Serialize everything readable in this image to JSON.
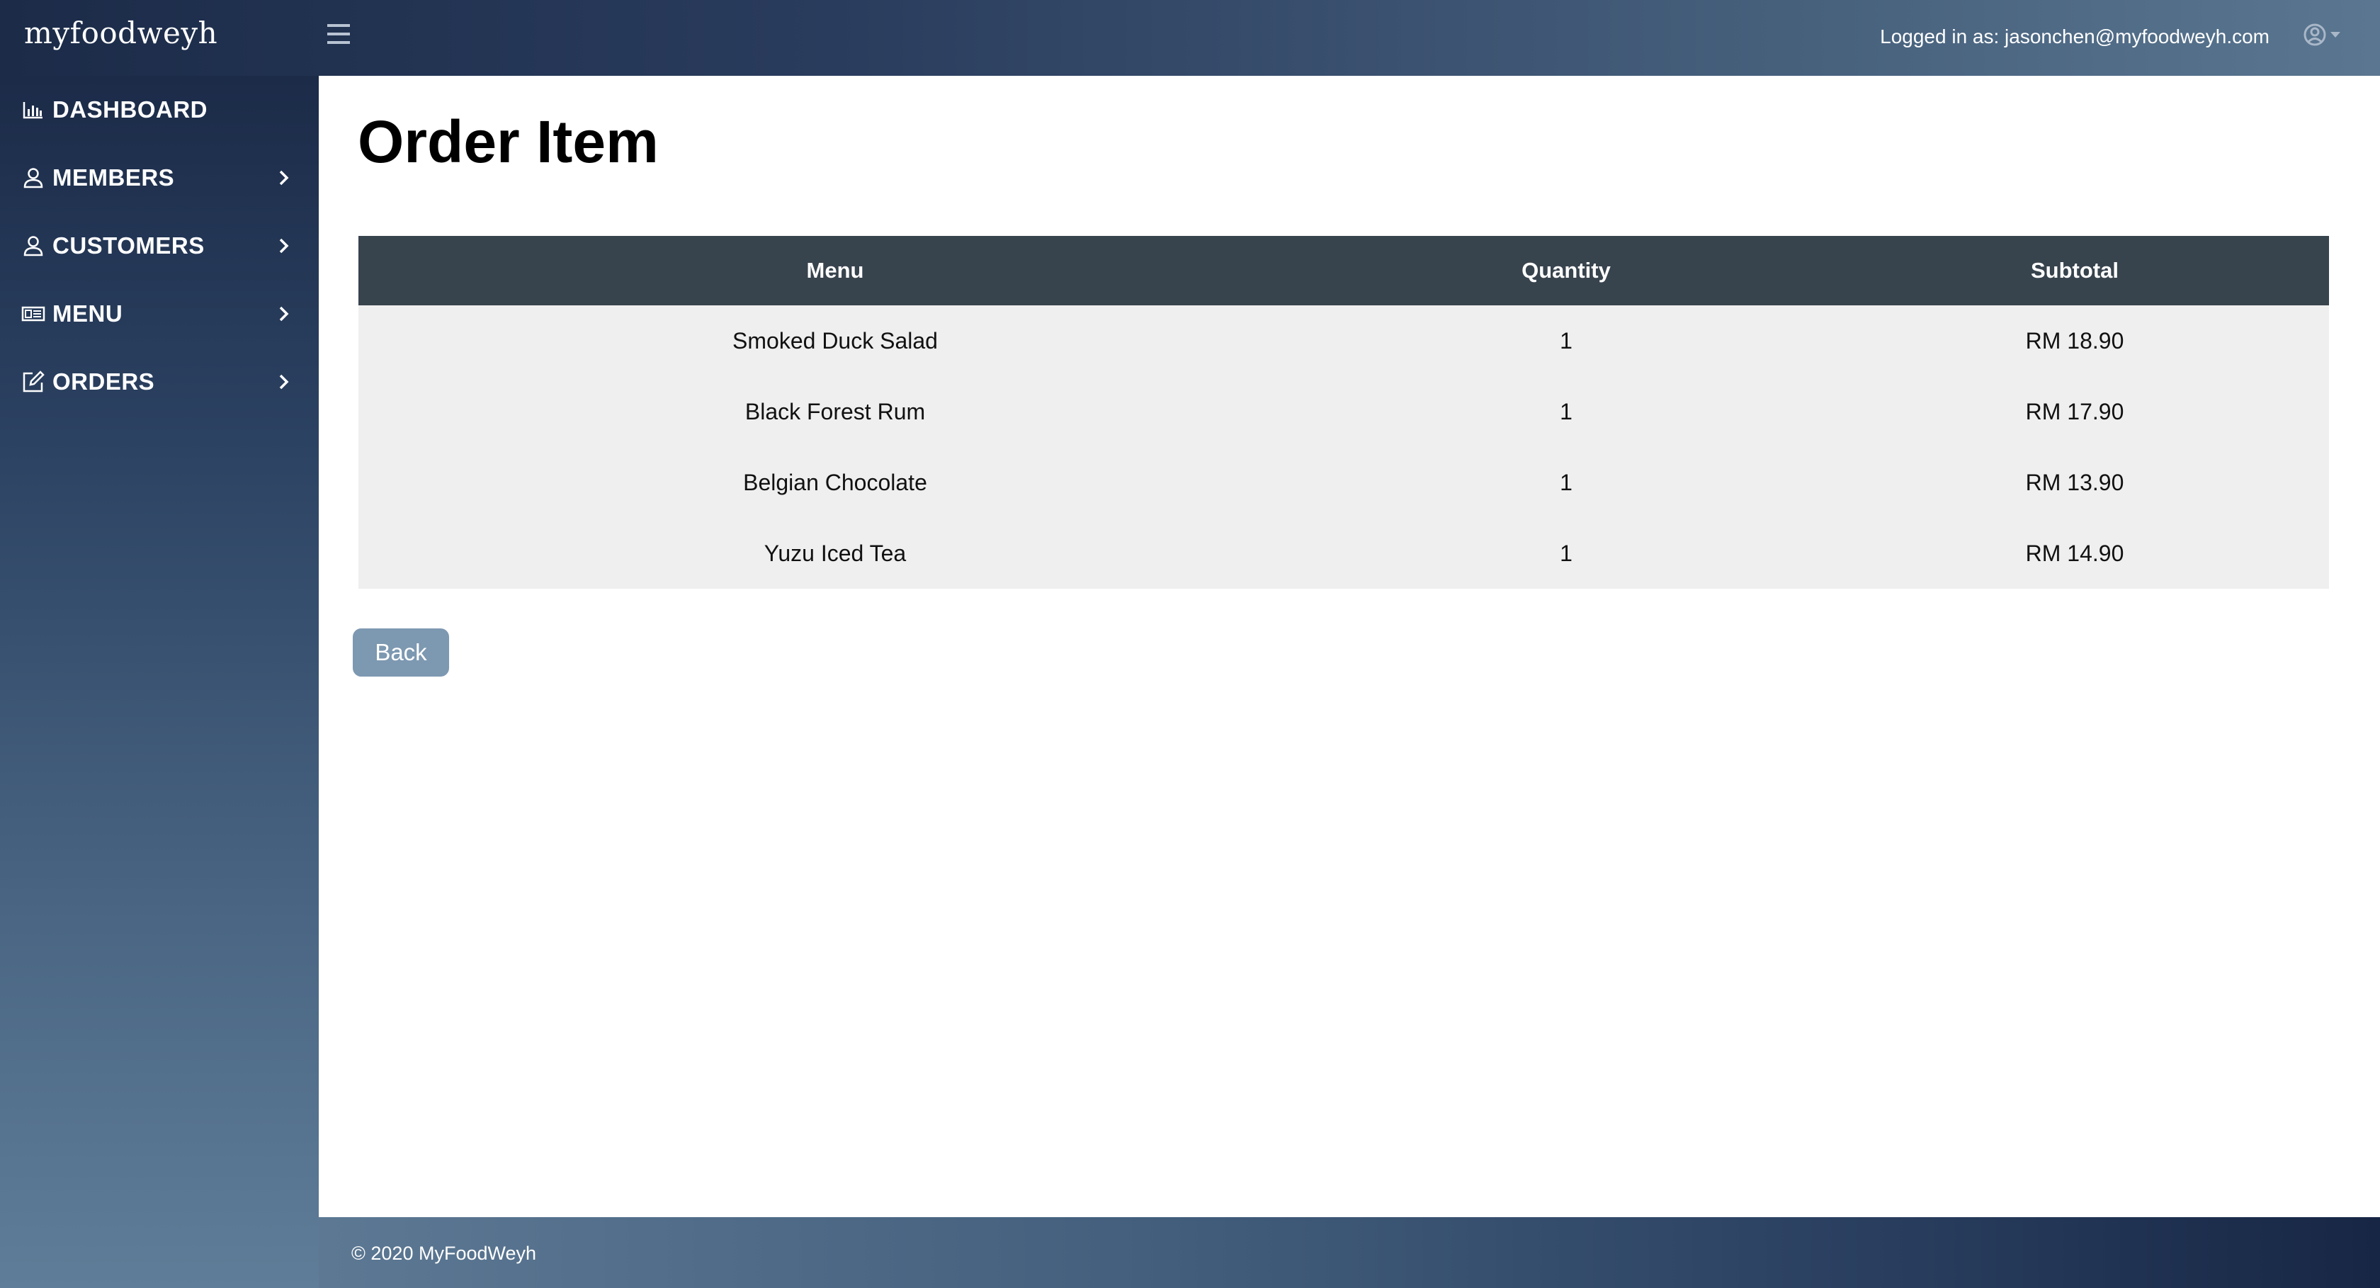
{
  "app": {
    "brand": "myfoodweyh"
  },
  "header": {
    "login_info": "Logged in as: jasonchen@myfoodweyh.com"
  },
  "sidebar": {
    "items": [
      {
        "label": "DASHBOARD",
        "icon": "bar-chart-icon",
        "has_chevron": false
      },
      {
        "label": "MEMBERS",
        "icon": "user-icon",
        "has_chevron": true
      },
      {
        "label": "CUSTOMERS",
        "icon": "user-icon",
        "has_chevron": true
      },
      {
        "label": "MENU",
        "icon": "menu-card-icon",
        "has_chevron": true
      },
      {
        "label": "ORDERS",
        "icon": "edit-icon",
        "has_chevron": true
      }
    ]
  },
  "main": {
    "title": "Order Item",
    "table": {
      "headers": [
        "Menu",
        "Quantity",
        "Subtotal"
      ],
      "rows": [
        [
          "Smoked Duck Salad",
          "1",
          "RM 18.90"
        ],
        [
          "Black Forest Rum",
          "1",
          "RM 17.90"
        ],
        [
          "Belgian Chocolate",
          "1",
          "RM 13.90"
        ],
        [
          "Yuzu Iced Tea",
          "1",
          "RM 14.90"
        ]
      ]
    },
    "back_label": "Back"
  },
  "footer": {
    "copyright": "© 2020 MyFoodWeyh"
  },
  "colors": {
    "table_header": "#37434d",
    "table_row": "#efefef",
    "back_button": "#7d98b1",
    "sidebar_top": "#1b2b48",
    "sidebar_bottom": "#5f7d98"
  }
}
